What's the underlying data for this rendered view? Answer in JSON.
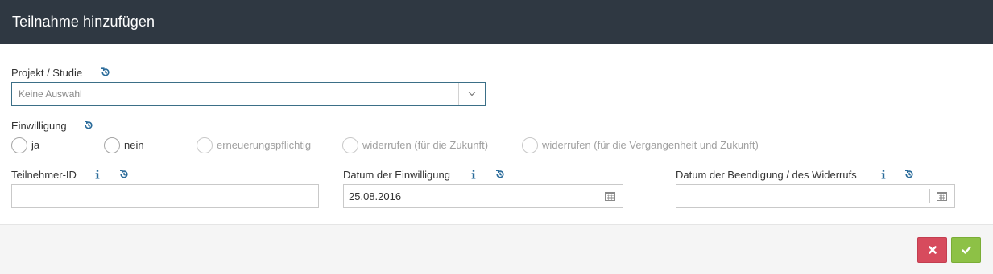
{
  "dialog": {
    "title": "Teilnahme hinzufügen"
  },
  "project": {
    "label": "Projekt / Studie",
    "selected": "Keine Auswahl",
    "history_icon": "history-icon",
    "dropdown_icon": "chevron-down-icon"
  },
  "consent": {
    "label": "Einwilligung",
    "history_icon": "history-icon",
    "options": [
      {
        "label": "ja",
        "selected": false
      },
      {
        "label": "nein",
        "selected": false
      },
      {
        "label": "erneuerungspflichtig",
        "selected": false
      },
      {
        "label": "widerrufen (für die Zukunft)",
        "selected": false
      },
      {
        "label": "widerrufen (für die Vergangenheit und Zukunft)",
        "selected": false
      }
    ]
  },
  "participant_id": {
    "label": "Teilnehmer-ID",
    "value": "",
    "info_icon": "info-icon",
    "history_icon": "history-icon"
  },
  "consent_date": {
    "label": "Datum der Einwilligung",
    "value": "25.08.2016",
    "info_icon": "info-icon",
    "history_icon": "history-icon",
    "calendar_icon": "calendar-icon"
  },
  "end_date": {
    "label": "Datum der Beendigung / des Widerrufs",
    "value": "",
    "info_icon": "info-icon",
    "history_icon": "history-icon",
    "calendar_icon": "calendar-icon"
  },
  "footer": {
    "cancel_icon": "close-icon",
    "confirm_icon": "check-icon"
  },
  "colors": {
    "header_bg": "#2f3842",
    "accent_blue": "#2a6b9a",
    "cancel_red": "#d74b5d",
    "confirm_green": "#8dc146",
    "footer_bg": "#f5f5f5"
  }
}
